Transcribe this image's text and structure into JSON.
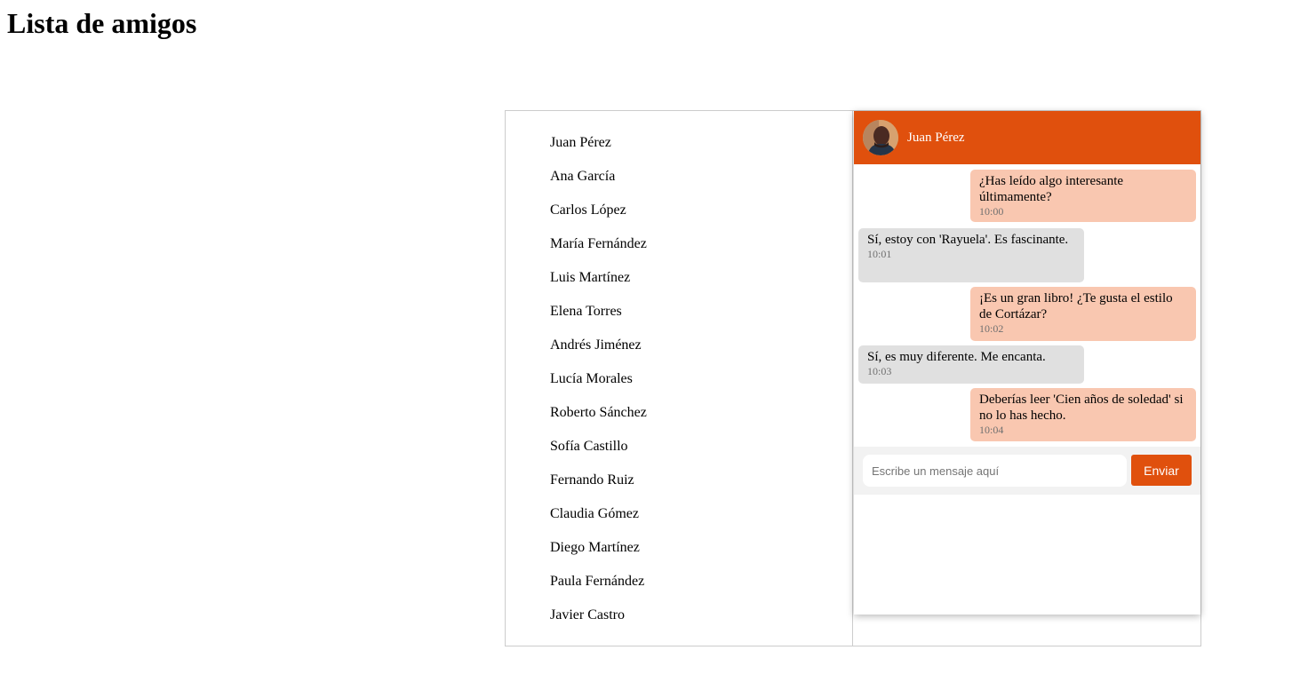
{
  "page": {
    "title": "Lista de amigos"
  },
  "friends": [
    "Juan Pérez",
    "Ana García",
    "Carlos López",
    "María Fernández",
    "Luis Martínez",
    "Elena Torres",
    "Andrés Jiménez",
    "Lucía Morales",
    "Roberto Sánchez",
    "Sofía Castillo",
    "Fernando Ruiz",
    "Claudia Gómez",
    "Diego Martínez",
    "Paula Fernández",
    "Javier Castro"
  ],
  "chat": {
    "contact_name": "Juan Pérez",
    "avatar_icon": "user-avatar-icon",
    "messages": [
      {
        "direction": "sent",
        "text": "¿Has leído algo interesante últimamente?",
        "time": "10:00"
      },
      {
        "direction": "received",
        "text": "Sí, estoy con 'Rayuela'. Es fascinante.",
        "time": "10:01"
      },
      {
        "direction": "sent",
        "text": "¡Es un gran libro! ¿Te gusta el estilo de Cortázar?",
        "time": "10:02"
      },
      {
        "direction": "received",
        "text": "Sí, es muy diferente. Me encanta.",
        "time": "10:03"
      },
      {
        "direction": "sent",
        "text": "Deberías leer 'Cien años de soledad' si no lo has hecho.",
        "time": "10:04"
      }
    ],
    "input": {
      "placeholder": "Escribe un mensaje aquí",
      "value": ""
    },
    "send_label": "Enviar"
  },
  "colors": {
    "accent": "#e0500d",
    "sent_bubble": "#f9c7b0",
    "received_bubble": "#e0e0e0",
    "input_bar": "#f2f2f2"
  }
}
